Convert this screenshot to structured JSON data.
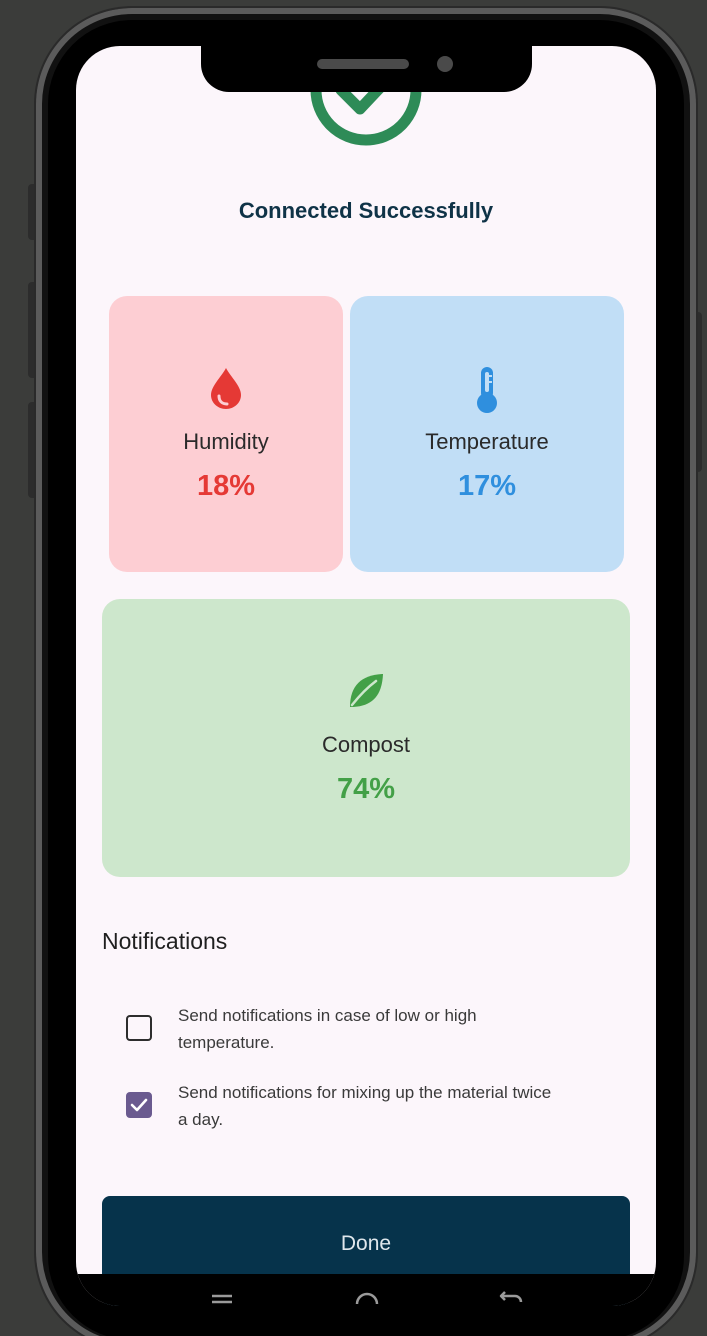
{
  "status": {
    "title": "Connected Successfully",
    "check_icon": "check-circle-icon",
    "color": "#2e8b57"
  },
  "metrics": {
    "humidity": {
      "label": "Humidity",
      "value": "18%",
      "icon": "water-drop-icon",
      "color": "#e53935",
      "bg": "#fdced3"
    },
    "temperature": {
      "label": "Temperature",
      "value": "17%",
      "icon": "thermometer-icon",
      "color": "#2f8fde",
      "bg": "#c1def6"
    },
    "compost": {
      "label": "Compost",
      "value": "74%",
      "icon": "leaf-icon",
      "color": "#43a047",
      "bg": "#cde7cc"
    }
  },
  "notifications": {
    "heading": "Notifications",
    "options": [
      {
        "line1": "Send notifications in case of low or high",
        "line2": "temperature.",
        "checked": false
      },
      {
        "line1": "Send notifications for mixing up the material twice",
        "line2": "a day.",
        "checked": true
      }
    ]
  },
  "done_button": {
    "label": "Done"
  },
  "nav_bar": {
    "icons": [
      "menu-icon",
      "home-icon",
      "back-icon"
    ]
  }
}
